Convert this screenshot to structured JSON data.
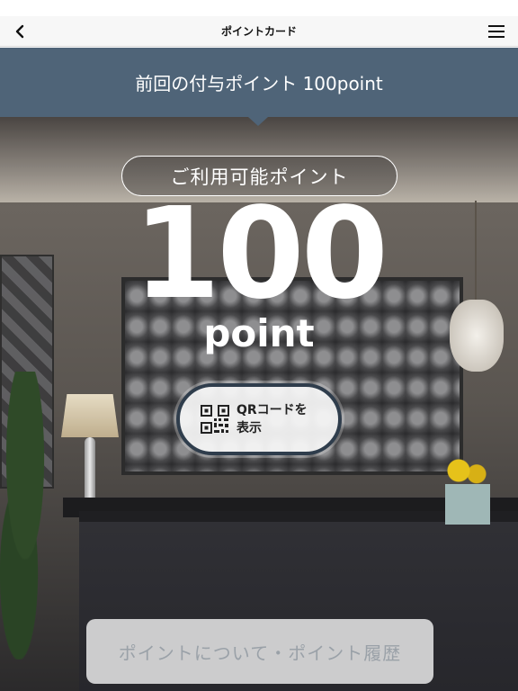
{
  "nav": {
    "title": "ポイントカード",
    "back_icon": "chevron-left-icon",
    "menu_icon": "hamburger-menu-icon"
  },
  "banner": {
    "text": "前回の付与ポイント 100point",
    "color": "#4f6478"
  },
  "points": {
    "available_label": "ご利用可能ポイント",
    "value": "100",
    "unit": "point"
  },
  "qr_button": {
    "label": "QRコードを表示",
    "icon": "qr-code-icon"
  },
  "history_button": {
    "label": "ポイントについて・ポイント履歴"
  }
}
